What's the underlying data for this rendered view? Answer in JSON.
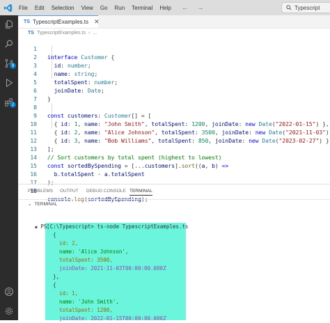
{
  "menu": [
    "File",
    "Edit",
    "Selection",
    "View",
    "Go",
    "Run",
    "Terminal",
    "Help"
  ],
  "command_center": {
    "text": "Typescript"
  },
  "activity_badges": {
    "source_control": "9",
    "extensions": "2"
  },
  "tab": {
    "label": "TypescriptExamples.ts",
    "icon": "TS"
  },
  "breadcrumb": {
    "file": "TypescriptExamples.ts",
    "more": "..."
  },
  "code_lines": [
    {
      "num": "1",
      "text": "interface Customer {"
    },
    {
      "num": "2",
      "text": "  id: number;"
    },
    {
      "num": "3",
      "text": "  name: string;"
    },
    {
      "num": "4",
      "text": "  totalSpent: number;"
    },
    {
      "num": "5",
      "text": "  joinDate: Date;"
    },
    {
      "num": "6",
      "text": "}"
    },
    {
      "num": "7",
      "text": ""
    },
    {
      "num": "8",
      "text": "const customers: Customer[] = ["
    },
    {
      "num": "9",
      "text": "  { id: 1, name: \"John Smith\", totalSpent: 1200, joinDate: new Date(\"2022-01-15\") },"
    },
    {
      "num": "10",
      "text": "  { id: 2, name: \"Alice Johnson\", totalSpent: 3500, joinDate: new Date(\"2021-11-03\") },"
    },
    {
      "num": "11",
      "text": "  { id: 3, name: \"Bob Williams\", totalSpent: 850, joinDate: new Date(\"2023-02-27\") }"
    },
    {
      "num": "12",
      "text": "];"
    },
    {
      "num": "13",
      "text": "// Sort customers by total spent (highest to lowest)"
    },
    {
      "num": "14",
      "text": "const sortedBySpending = [...customers].sort((a, b) =>"
    },
    {
      "num": "15",
      "text": "  b.totalSpent - a.totalSpent"
    },
    {
      "num": "16",
      "text": ");"
    },
    {
      "num": "17",
      "text": ""
    },
    {
      "num": "18",
      "text": "console.log(sortedBySpending);"
    }
  ],
  "panel_tabs": [
    "PROBLEMS",
    "OUTPUT",
    "DEBUG CONSOLE",
    "TERMINAL"
  ],
  "terminal": {
    "header": "TERMINAL",
    "prompt": "PS C:\\Typescript> ts-node TypescriptExamples.ts",
    "output": [
      "[",
      "  {",
      "    id: 2,",
      "    name: 'Alice Johnson',",
      "    totalSpent: 3500,",
      "    joinDate: 2021-11-03T00:00:00.000Z",
      "  },",
      "  {",
      "    id: 1,",
      "    name: 'John Smith',",
      "    totalSpent: 1200,",
      "    joinDate: 2022-01-15T00:00:00.000Z",
      "  },",
      "  {"
    ]
  },
  "colors": {
    "activity_bar": "#2c2c2c",
    "highlight": "#6cf5dd",
    "accent": "#007acc"
  }
}
